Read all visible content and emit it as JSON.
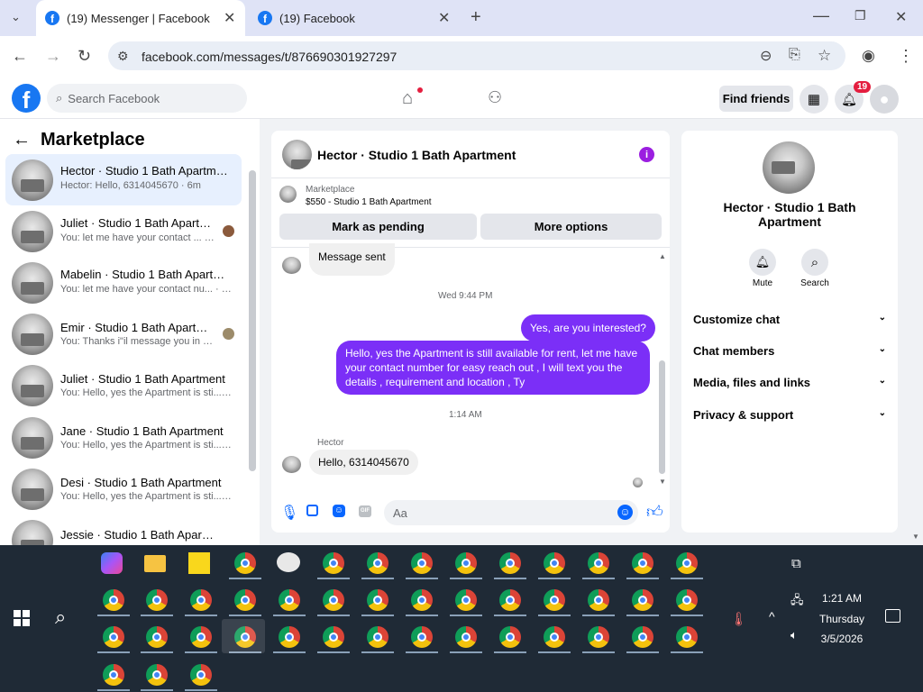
{
  "browser": {
    "tabs": [
      {
        "title": "(19) Messenger | Facebook",
        "active": true
      },
      {
        "title": "(19) Facebook",
        "active": false
      }
    ],
    "url": "facebook.com/messages/t/876690301927297"
  },
  "header": {
    "search_placeholder": "Search Facebook",
    "find_friends": "Find friends",
    "notif_count": "19"
  },
  "sidebar": {
    "title": "Marketplace",
    "conversations": [
      {
        "name": "Hector · Studio 1 Bath Apartment",
        "preview": "Hector: Hello, 6314045670 · 6m",
        "active": true
      },
      {
        "name": "Juliet · Studio 1 Bath Apartme...",
        "preview": "You: let me have your contact ... · 29m"
      },
      {
        "name": "Mabelin · Studio 1 Bath Apartm...",
        "preview": "You: let me have your contact nu... · 29m"
      },
      {
        "name": "Emir · Studio 1 Bath Apartment",
        "preview": "You: Thanks i\"il message you in ... · 3h"
      },
      {
        "name": "Juliet · Studio 1 Bath Apartment",
        "preview": "You: Hello, yes the Apartment is sti... · 3h"
      },
      {
        "name": "Jane · Studio 1 Bath Apartment",
        "preview": "You: Hello, yes the Apartment is sti... · 3h"
      },
      {
        "name": "Desi · Studio 1 Bath Apartment",
        "preview": "You: Hello, yes the Apartment is sti... · 3h"
      },
      {
        "name": "Jessie · Studio 1 Bath Apartm...",
        "preview": ""
      }
    ]
  },
  "chat": {
    "title": "Hector · Studio 1 Bath Apartment",
    "listing_label": "Marketplace",
    "listing_detail": "$550 - Studio 1 Bath Apartment",
    "mark_pending": "Mark as pending",
    "more_options": "More options",
    "messages": {
      "sent_notice": "Message sent",
      "time1": "Wed 9:44 PM",
      "out1": "Yes, are you interested?",
      "out2": "Hello, yes the Apartment  is still available for rent, let me have your contact number for easy reach out , I will text you the details , requirement and location , Ty",
      "time2": "1:14 AM",
      "sender": "Hector",
      "in1": "Hello, 6314045670"
    },
    "composer_placeholder": "Aa",
    "gif_label": "GIF"
  },
  "info": {
    "name": "Hector · Studio 1 Bath Apartment",
    "mute": "Mute",
    "search": "Search",
    "menu": [
      "Customize chat",
      "Chat members",
      "Media, files and links",
      "Privacy & support"
    ]
  },
  "taskbar": {
    "time": "1:21 AM",
    "day": "Thursday",
    "date": "3/5/2026"
  }
}
